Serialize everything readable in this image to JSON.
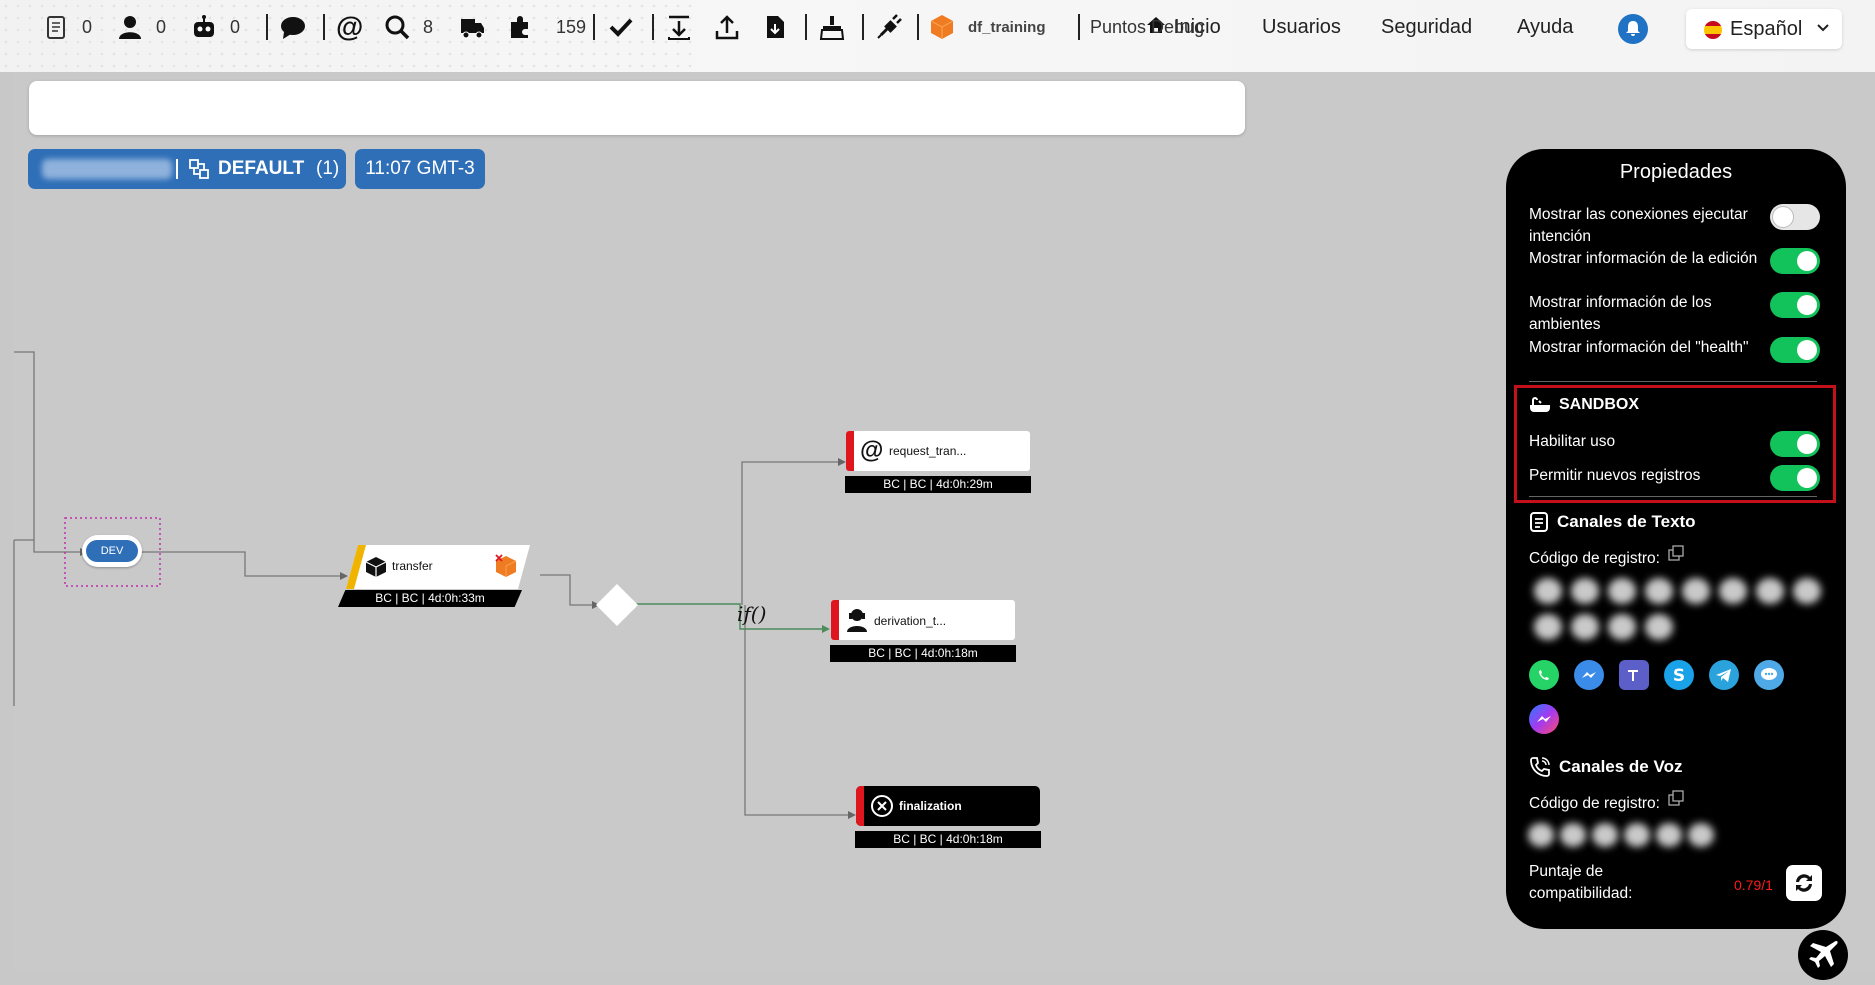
{
  "nav": {
    "items": [
      "Inicio",
      "Usuarios",
      "Seguridad",
      "Ayuda"
    ],
    "language": "Español"
  },
  "toolbar": {
    "counters": {
      "documents": "0",
      "agents": "0",
      "bots": "0",
      "search": "8",
      "transfer": "159"
    },
    "project": "df_training",
    "debug_button": "Puntos Debug"
  },
  "badges": {
    "group": "DEFAULT",
    "group_count": "(1)",
    "time": "11:07 GMT-3"
  },
  "flow": {
    "start_node": "DEV",
    "transfer": {
      "label": "transfer",
      "status": "BC | BC | 4d:0h:33m"
    },
    "request": {
      "label": "request_tran...",
      "status": "BC | BC | 4d:0h:29m"
    },
    "derivation": {
      "label": "derivation_t...",
      "status": "BC | BC | 4d:0h:18m"
    },
    "finalization": {
      "label": "finalization",
      "status": "BC | BC | 4d:0h:18m"
    },
    "condition_label": "if()"
  },
  "panel": {
    "title": "Propiedades",
    "toggles": [
      {
        "label": "Mostrar las conexiones ejecutar intención",
        "on": false
      },
      {
        "label": "Mostrar información de la edición",
        "on": true
      },
      {
        "label": "Mostrar información de los ambientes",
        "on": true
      },
      {
        "label": "Mostrar información del \"health\"",
        "on": true
      }
    ],
    "sandbox": {
      "title": "SANDBOX",
      "enable_label": "Habilitar uso",
      "new_records_label": "Permitir nuevos registros"
    },
    "text_channels": {
      "title": "Canales de Texto",
      "code_label": "Código de registro:"
    },
    "voice_channels": {
      "title": "Canales de Voz",
      "code_label": "Código de registro:"
    },
    "score_label": "Puntaje de compatibilidad:",
    "score_value": "0.79/1"
  },
  "colors": {
    "accent": "#2f6fb7",
    "toggle_on": "#12c25a",
    "alert": "#e0161f",
    "score": "#ff1a1a"
  }
}
